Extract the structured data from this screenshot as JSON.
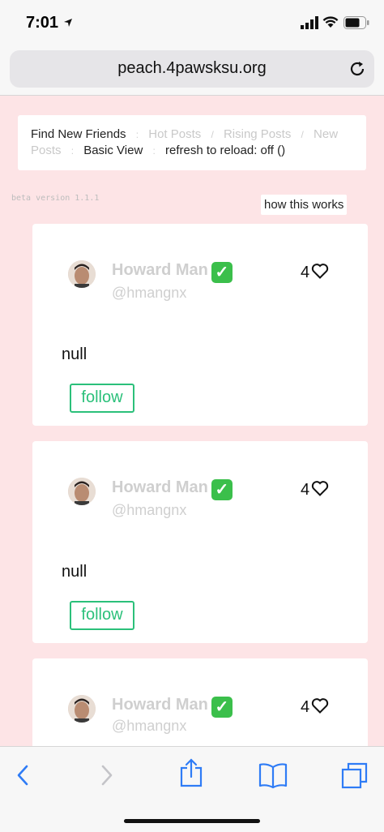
{
  "status": {
    "time": "7:01"
  },
  "browser": {
    "url": "peach.4pawsksu.org"
  },
  "nav": {
    "find_new_friends": "Find New Friends",
    "hot_posts": "Hot Posts",
    "rising_posts": "Rising Posts",
    "new_posts_line1": "New",
    "new_posts_line2": "Posts",
    "basic_view": "Basic View",
    "refresh": "refresh to reload: off ()",
    "sep1": ":",
    "sep2": "/",
    "sep3": "/",
    "sep4": ":",
    "sep5": ":"
  },
  "beta": "beta version 1.1.1",
  "how_this_works": "how this works",
  "posts": [
    {
      "name": "Howard Man",
      "verified": "✓",
      "handle": "@hmangnx",
      "likes": "4",
      "text": "null",
      "follow": "follow"
    },
    {
      "name": "Howard Man",
      "verified": "✓",
      "handle": "@hmangnx",
      "likes": "4",
      "text": "null",
      "follow": "follow"
    },
    {
      "name": "Howard Man",
      "verified": "✓",
      "handle": "@hmangnx",
      "likes": "4",
      "text": "",
      "follow": ""
    }
  ],
  "colors": {
    "background": "#fde4e6",
    "follow_green": "#2bc07a",
    "verified_green": "#3bbf4b",
    "ios_blue": "#2f7cf6"
  },
  "icons": [
    "location-arrow-icon",
    "signal-icon",
    "wifi-icon",
    "battery-icon",
    "reload-icon",
    "verified-check-icon",
    "heart-icon",
    "back-icon",
    "forward-icon",
    "share-icon",
    "bookmarks-icon",
    "tabs-icon"
  ]
}
